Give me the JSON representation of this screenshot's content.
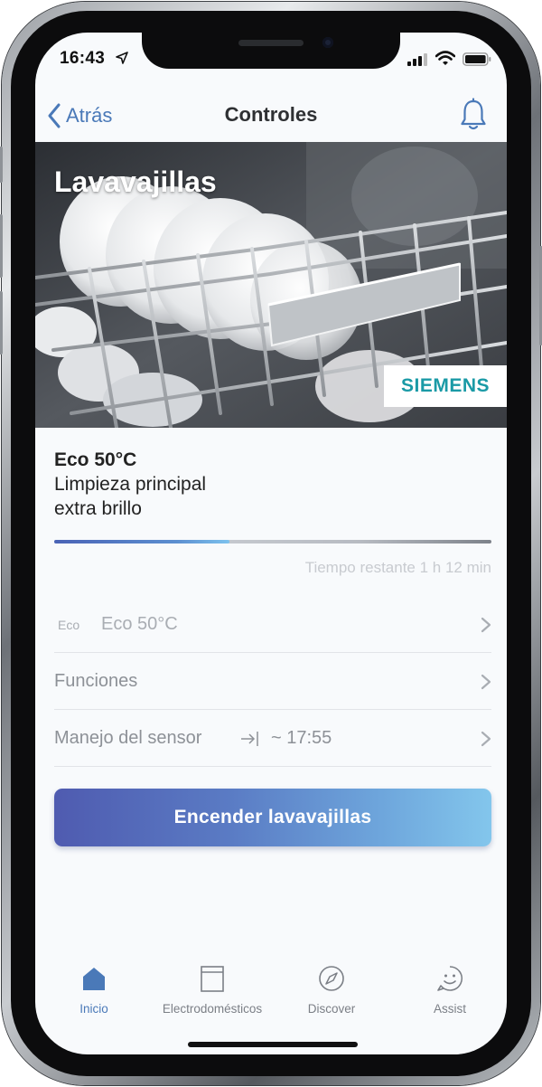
{
  "status_bar": {
    "time": "16:43"
  },
  "nav": {
    "back_label": "Atrás",
    "title": "Controles"
  },
  "hero": {
    "appliance_title": "Lavavajillas",
    "brand": "SIEMENS"
  },
  "program": {
    "name": "Eco 50°C",
    "phase_line1": "Limpieza principal",
    "phase_line2": "extra brillo",
    "progress": 0.4,
    "remaining_text": "Tiempo restante 1 h 12 min"
  },
  "rows": {
    "program_badge": "Eco",
    "program_label": "Eco 50°C",
    "functions_label": "Funciones",
    "sensor_label": "Manejo del sensor",
    "sensor_time": "~ 17:55"
  },
  "main_button": {
    "label": "Encender lavavajillas"
  },
  "tabs": [
    {
      "label": "Inicio",
      "icon": "home-icon",
      "active": true
    },
    {
      "label": "Electrodomésticos",
      "icon": "appliance-icon",
      "active": false
    },
    {
      "label": "Discover",
      "icon": "compass-icon",
      "active": false
    },
    {
      "label": "Assist",
      "icon": "smiley-icon",
      "active": false
    }
  ],
  "colors": {
    "accent": "#4a79b8",
    "brand": "#1a9aa6",
    "button_gradient_start": "#4f5bb0",
    "button_gradient_end": "#83c6ec"
  }
}
